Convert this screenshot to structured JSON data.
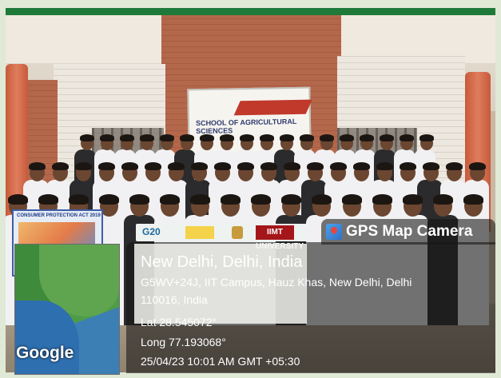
{
  "photo": {
    "banner_text": "SCHOOL OF AGRICULTURAL SCIENCES",
    "poster_left_title": "CONSUMER PROTECTION ACT 2019",
    "strip": {
      "g20_label": "G20",
      "iimt_label": "IIMT UNIVERSITY"
    }
  },
  "overlay": {
    "watermark": "Google",
    "app_name": "GPS Map Camera",
    "location_title": "New Delhi, Delhi, India",
    "address_line1": "G5WV+24J, IIT Campus, Hauz Khas, New Delhi, Delhi",
    "address_line2": "110016, India",
    "latitude": "Lat 28.545072°",
    "longitude": "Long 77.193068°",
    "timestamp": "25/04/23 10:01 AM GMT +05:30",
    "icon": "map-pin-icon",
    "colors": {
      "app_icon": "#2f6fc9",
      "pin": "#e8453c"
    }
  }
}
